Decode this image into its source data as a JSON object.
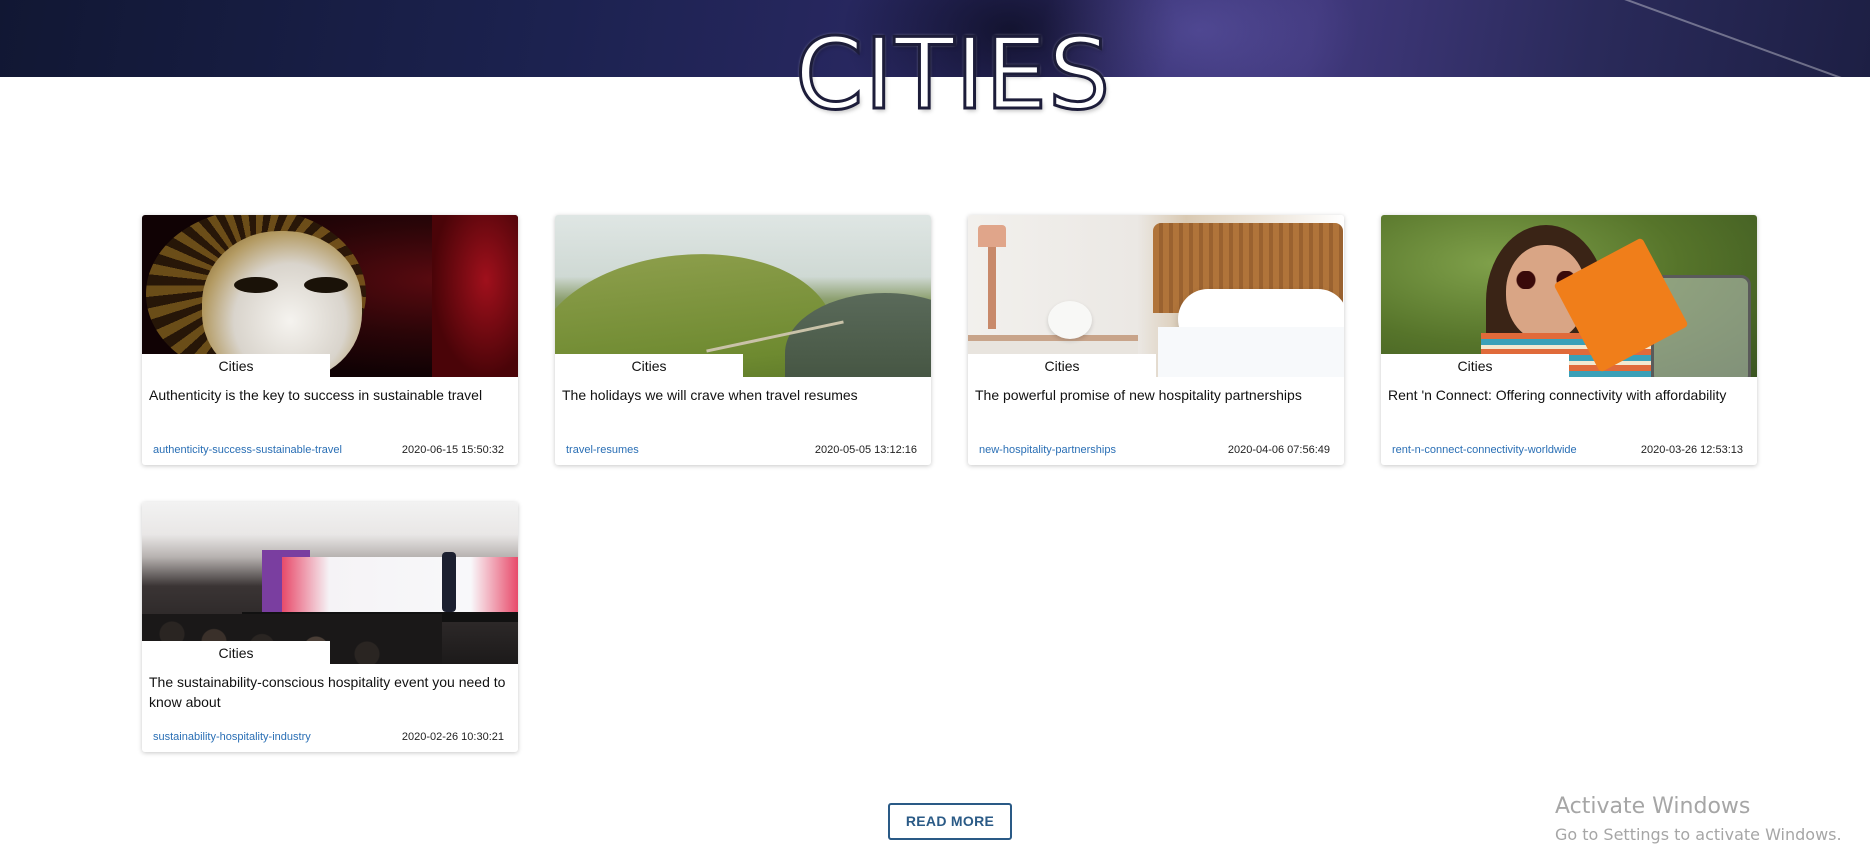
{
  "header": {
    "title": "CITIES"
  },
  "articles": [
    {
      "category": "Cities",
      "title": "Authenticity is the key to success in sustainable travel",
      "slug": "authenticity-success-sustainable-travel",
      "date": "2020-06-15 15:50:32",
      "image": "venetian-mask-photo"
    },
    {
      "category": "Cities",
      "title": "The holidays we will crave when travel resumes",
      "slug": "travel-resumes",
      "date": "2020-05-05 13:12:16",
      "image": "green-hills-hikers-photo"
    },
    {
      "category": "Cities",
      "title": "The powerful promise of new hospitality partnerships",
      "slug": "new-hospitality-partnerships",
      "date": "2020-04-06 07:56:49",
      "image": "hotel-bedroom-photo"
    },
    {
      "category": "Cities",
      "title": "Rent 'n Connect: Offering connectivity with affordability",
      "slug": "rent-n-connect-connectivity-worldwide",
      "date": "2020-03-26 12:53:13",
      "image": "woman-with-orange-folder-photo"
    },
    {
      "category": "Cities",
      "title": "The sustainability-conscious hospitality event you need to know about",
      "slug": "sustainability-hospitality-industry",
      "date": "2020-02-26 10:30:21",
      "image": "conference-stage-photo"
    }
  ],
  "read_more_label": "READ MORE",
  "watermark": {
    "line1": "Activate Windows",
    "line2": "Go to Settings to activate Windows."
  }
}
